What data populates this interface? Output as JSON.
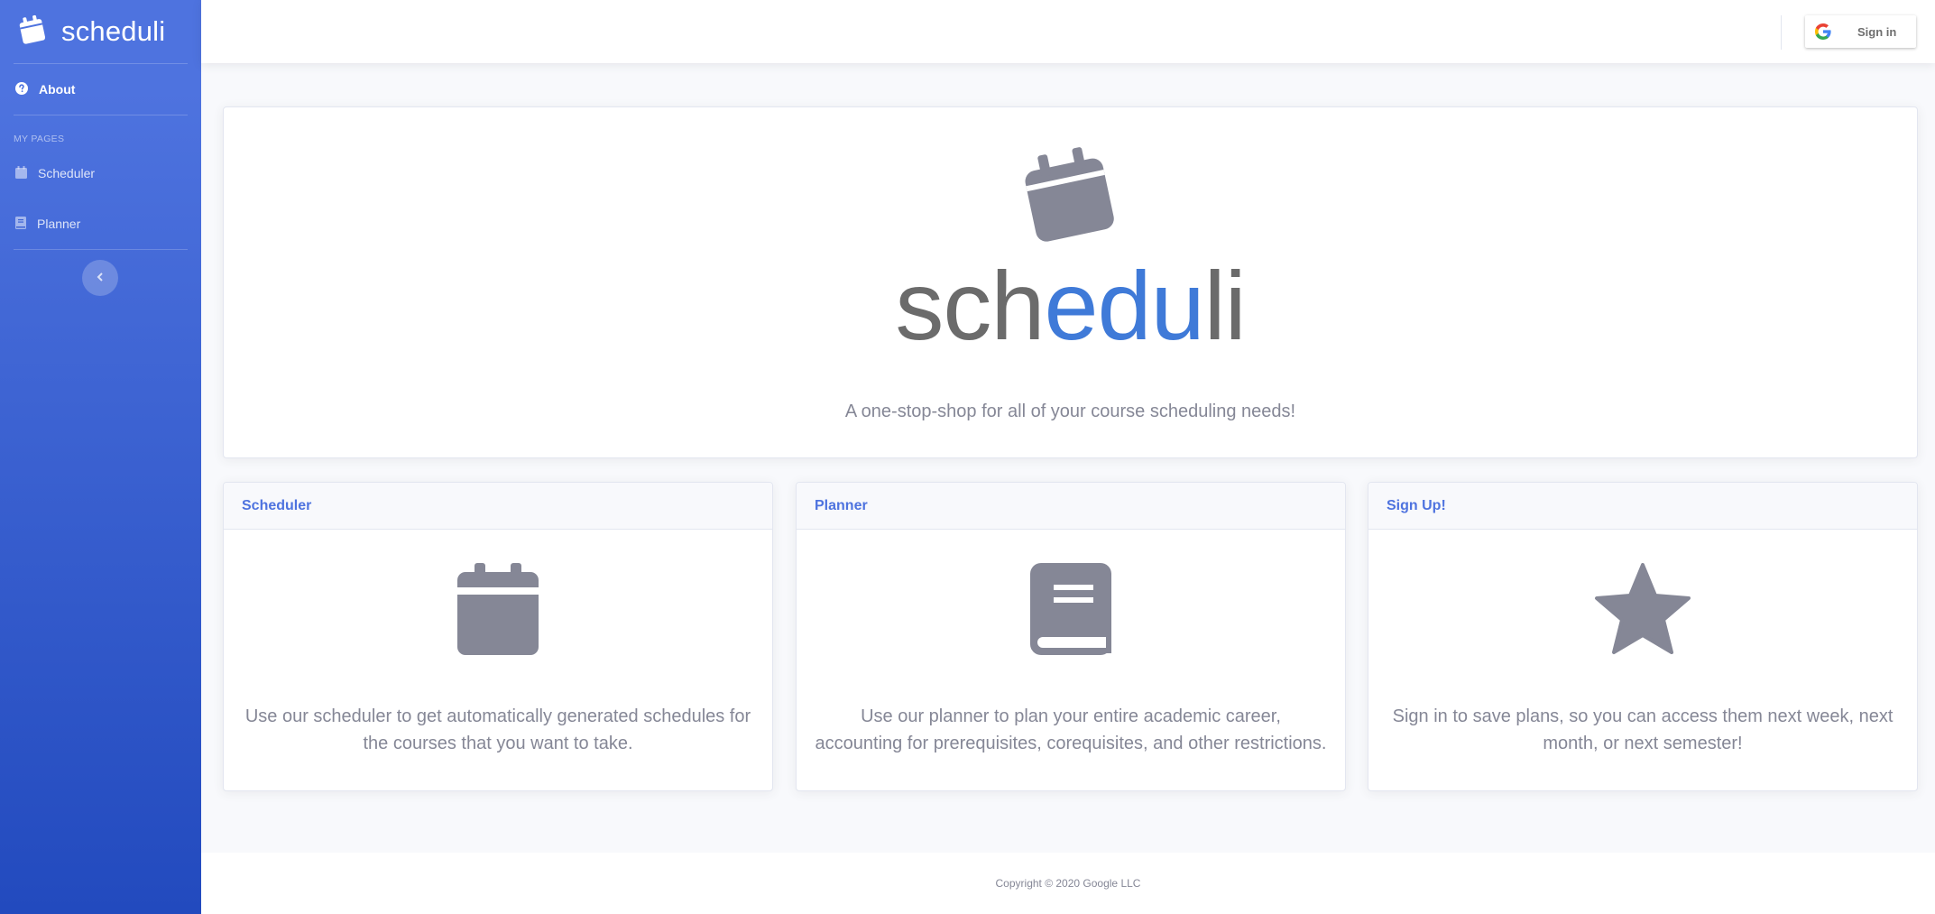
{
  "brand": {
    "name": "scheduli",
    "name_gray_1": "sch",
    "name_blue": "edu",
    "name_gray_2": "li"
  },
  "sidebar": {
    "items": [
      {
        "label": "About",
        "icon": "question-circle-icon",
        "active": true
      },
      {
        "label": "Scheduler",
        "icon": "calendar-icon",
        "active": false
      },
      {
        "label": "Planner",
        "icon": "book-icon",
        "active": false
      }
    ],
    "heading": "MY PAGES",
    "toggle_icon": "chevron-left-icon"
  },
  "topbar": {
    "signin_label": "Sign in",
    "signin_icon": "google-icon"
  },
  "hero": {
    "icon": "calendar-icon",
    "tagline": "A one-stop-shop for all of your course scheduling needs!"
  },
  "features": [
    {
      "title": "Scheduler",
      "icon": "calendar-icon",
      "text": "Use our scheduler to get automatically generated schedules for the courses that you want to take."
    },
    {
      "title": "Planner",
      "icon": "book-icon",
      "text": "Use our planner to plan your entire academic career, accounting for prerequisites, corequisites, and other restrictions."
    },
    {
      "title": "Sign Up!",
      "icon": "star-icon",
      "text": "Sign in to save plans, so you can access them next week, next month, or next semester!"
    }
  ],
  "footer": {
    "copyright": "Copyright © 2020 Google LLC"
  },
  "colors": {
    "sidebar_top": "#4e73df",
    "sidebar_bottom": "#224abe",
    "accent": "#4e73df",
    "logo_blue": "#3f7ad8",
    "logo_gray": "#6b6b6b",
    "icon_gray": "#858796"
  }
}
